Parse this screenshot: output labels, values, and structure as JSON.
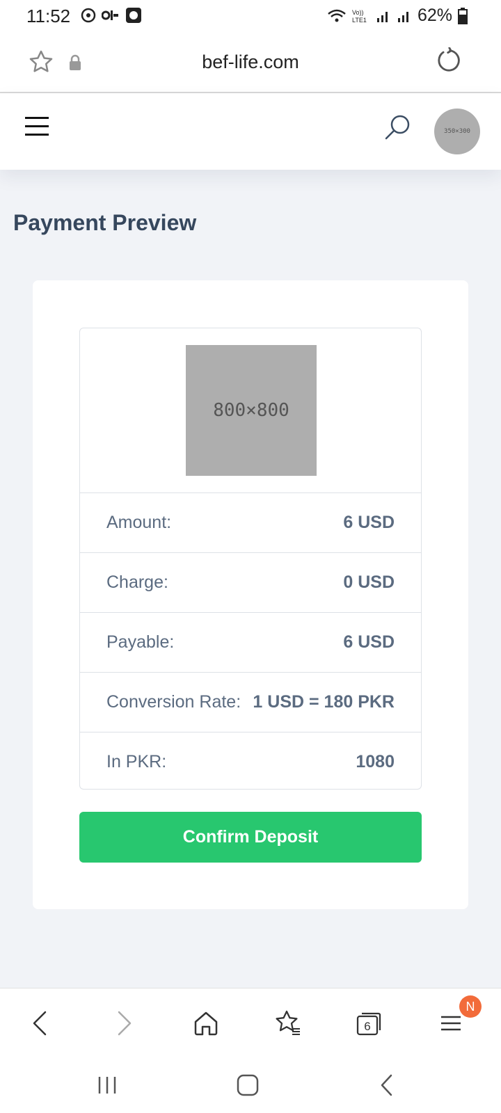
{
  "status_bar": {
    "time": "11:52",
    "battery": "62%",
    "icons_left": [
      "timer-icon",
      "app-icon",
      "app-square-icon"
    ],
    "icons_right": [
      "wifi-icon",
      "volte-icon",
      "signal-icon",
      "signal-icon",
      "battery-icon"
    ]
  },
  "browser": {
    "url": "bef-life.com"
  },
  "header": {
    "avatar_label": "350×300"
  },
  "page": {
    "title": "Payment Preview"
  },
  "preview": {
    "image_label": "800×800",
    "rows": [
      {
        "label": "Amount:",
        "value": "6 USD"
      },
      {
        "label": "Charge:",
        "value": "0 USD"
      },
      {
        "label": "Payable:",
        "value": "6 USD"
      },
      {
        "label": "Conversion Rate:",
        "value": "1 USD = 180 PKR"
      },
      {
        "label": "In PKR:",
        "value": "1080"
      }
    ],
    "confirm_label": "Confirm Deposit"
  },
  "toolbar": {
    "tabs_count": "6",
    "menu_badge": "N"
  },
  "colors": {
    "accent": "#28c76f",
    "title": "#36475d",
    "badge": "#f26b3a"
  }
}
